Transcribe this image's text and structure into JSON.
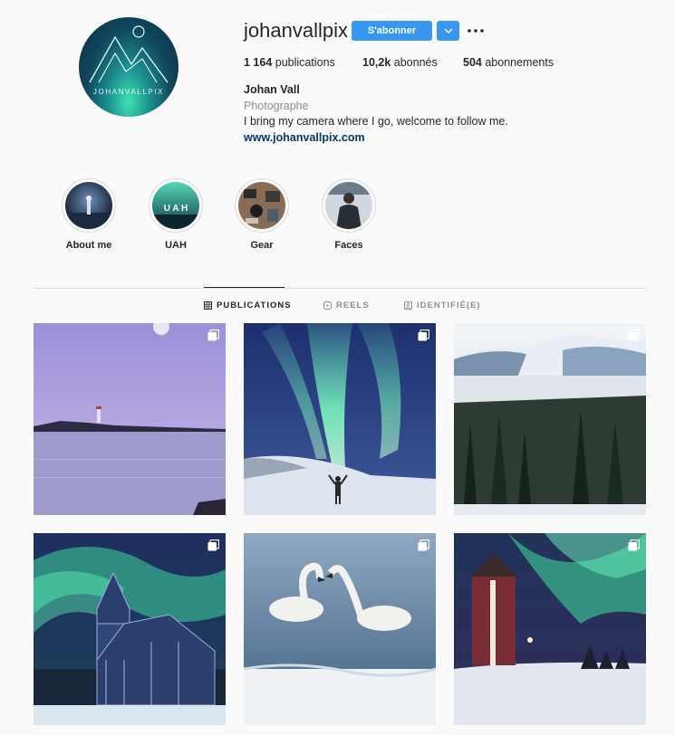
{
  "profile": {
    "username": "johanvallpix",
    "avatar_text": "JOHANVALLPIX",
    "follow_label": "S'abonner",
    "more_icon": "chevron-down-icon",
    "options_icon": "more-horizontal-icon",
    "full_name": "Johan Vall",
    "category": "Photographe",
    "bio": "I bring my camera where I go, welcome to follow me.",
    "website": "www.johanvallpix.com",
    "accent_color": "#3897f0"
  },
  "stats": {
    "posts_count": "1 164",
    "posts_label": "publications",
    "followers_count": "10,2k",
    "followers_label": "abonnés",
    "following_count": "504",
    "following_label": "abonnements"
  },
  "highlights": [
    {
      "label": "About me"
    },
    {
      "label": "UAH",
      "image_text": "U A H"
    },
    {
      "label": "Gear"
    },
    {
      "label": "Faces"
    }
  ],
  "tabs": [
    {
      "label": "PUBLICATIONS",
      "icon": "grid-icon",
      "active": true
    },
    {
      "label": "REELS",
      "icon": "reels-icon",
      "active": false
    },
    {
      "label": "IDENTIFIÉ(E)",
      "icon": "tagged-icon",
      "active": false
    }
  ],
  "posts": [
    {
      "subject": "lighthouse-lake-dusk",
      "multiple": true
    },
    {
      "subject": "aurora-person",
      "multiple": true
    },
    {
      "subject": "snow-mountain-forest",
      "multiple": true
    },
    {
      "subject": "aurora-glass-church",
      "multiple": true
    },
    {
      "subject": "swans-heart",
      "multiple": true
    },
    {
      "subject": "aurora-tower",
      "multiple": true
    }
  ]
}
